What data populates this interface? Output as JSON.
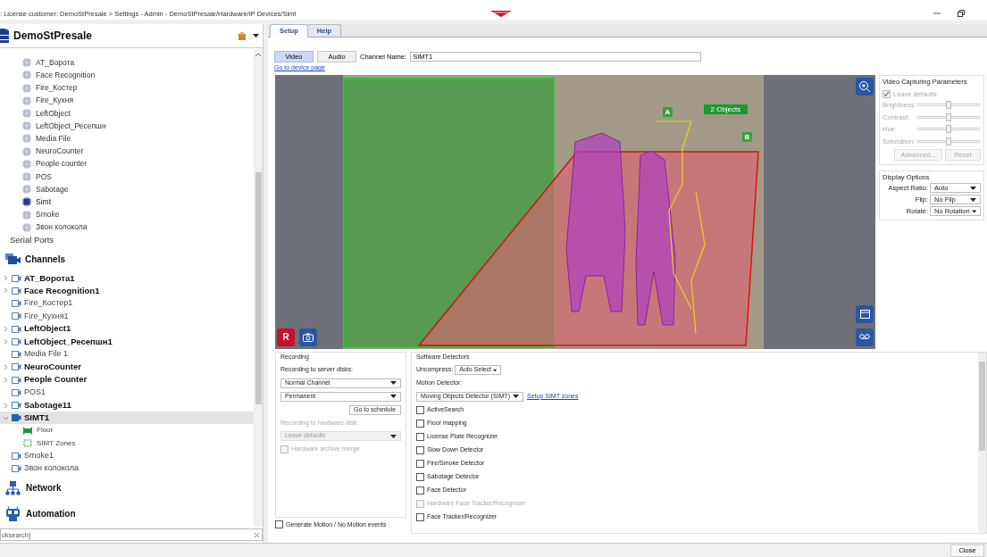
{
  "window": {
    "title": ": License customer: DemoStPresale > Settings - Admin - DemoStPresale/Hardware/IP Devices/Simt"
  },
  "sidebar": {
    "server": "DemoStPresale",
    "devices": [
      {
        "label": "AT_Ворота",
        "selected": false
      },
      {
        "label": "Face Recognition",
        "selected": false
      },
      {
        "label": "Fire_Костер",
        "selected": false
      },
      {
        "label": "Fire_Кухня",
        "selected": false
      },
      {
        "label": "LeftObject",
        "selected": false
      },
      {
        "label": "LeftObject_Ресепшн",
        "selected": false
      },
      {
        "label": "Media File",
        "selected": false
      },
      {
        "label": "NeuroCounter",
        "selected": false
      },
      {
        "label": "People counter",
        "selected": false
      },
      {
        "label": "POS",
        "selected": false
      },
      {
        "label": "Sabotage",
        "selected": false
      },
      {
        "label": "Simt",
        "selected": true
      },
      {
        "label": "Smoke",
        "selected": false
      },
      {
        "label": "Звон колокола",
        "selected": false
      }
    ],
    "serial_ports": "Serial Ports",
    "channels_title": "Channels",
    "channels": [
      {
        "label": "AT_Ворота1",
        "bold": true,
        "expandable": true,
        "expanded": false,
        "selected": false
      },
      {
        "label": "Face Recognition1",
        "bold": true,
        "expandable": true,
        "expanded": false,
        "selected": false
      },
      {
        "label": "Fire_Костер1",
        "bold": false,
        "expandable": false,
        "selected": false
      },
      {
        "label": "Fire_Кухня1",
        "bold": false,
        "expandable": false,
        "selected": false
      },
      {
        "label": "LeftObject1",
        "bold": true,
        "expandable": true,
        "expanded": false,
        "selected": false
      },
      {
        "label": "LeftObject_Ресепшн1",
        "bold": true,
        "expandable": true,
        "expanded": false,
        "selected": false
      },
      {
        "label": "Media File 1",
        "bold": false,
        "expandable": false,
        "selected": false
      },
      {
        "label": "NeuroCounter",
        "bold": true,
        "expandable": true,
        "expanded": false,
        "selected": false
      },
      {
        "label": "People Counter",
        "bold": true,
        "expandable": true,
        "expanded": false,
        "selected": false
      },
      {
        "label": "POS1",
        "bold": false,
        "expandable": false,
        "selected": false
      },
      {
        "label": "Sabotage11",
        "bold": true,
        "expandable": true,
        "expanded": false,
        "selected": false
      },
      {
        "label": "SIMT1",
        "bold": true,
        "expandable": true,
        "expanded": true,
        "selected": true,
        "children": [
          {
            "label": "Floor",
            "kind": "floor"
          },
          {
            "label": "SIMT Zones",
            "kind": "zones"
          }
        ]
      },
      {
        "label": "Smoke1",
        "bold": false,
        "expandable": false,
        "selected": false
      },
      {
        "label": "Звон колокола",
        "bold": false,
        "expandable": false,
        "selected": false
      }
    ],
    "sections": [
      {
        "label": "Network",
        "kind": "network"
      },
      {
        "label": "Automation",
        "kind": "automation"
      }
    ],
    "search": {
      "placeholder": "cksearch]"
    }
  },
  "tabs": [
    {
      "label": "Setup",
      "selected": true
    },
    {
      "label": "Help",
      "selected": false
    }
  ],
  "media_buttons": [
    {
      "label": "Video",
      "selected": true
    },
    {
      "label": "Audio",
      "selected": false
    }
  ],
  "channel_name": {
    "label": "Channel Name:",
    "value": "SIMT1"
  },
  "device_link": "Go to device page",
  "video": {
    "zone_labels": [
      {
        "label": "A",
        "kind": "tag"
      },
      {
        "label": "2 Objects",
        "kind": "count"
      },
      {
        "label": "B",
        "kind": "tag"
      }
    ],
    "record_button": "R"
  },
  "capture": {
    "title": "Video Capturing Parameters",
    "leave_defaults": {
      "label": "Leave defaults",
      "checked": true,
      "disabled": true
    },
    "sliders": [
      {
        "label": "Brightness:",
        "level": 0.5
      },
      {
        "label": "Contrast:",
        "level": 0.5
      },
      {
        "label": "Hue:",
        "level": 0.5
      },
      {
        "label": "Saturation:",
        "level": 0.5
      }
    ],
    "buttons": [
      "Advanced...",
      "Reset"
    ]
  },
  "display": {
    "title": "Display Options",
    "rows": [
      {
        "label": "Aspect Ratio:",
        "value": "Auto"
      },
      {
        "label": "Flip:",
        "value": "No Flip"
      },
      {
        "label": "Rotate:",
        "value": "No Rotation"
      }
    ]
  },
  "recording": {
    "title": "Recording",
    "server_label": "Recording to server disks:",
    "mode": "Normal Channel",
    "schedule": "Permanent",
    "schedule_button": "Go to schedule",
    "hardware_label": "Recording to hardware disk:",
    "hardware_value": "Leave defaults",
    "merge": {
      "label": "Hardware archive merge",
      "checked": false,
      "disabled": true
    }
  },
  "generate_events": {
    "label": "Generate Motion / No Motion events",
    "checked": false
  },
  "detectors": {
    "title": "Software Detectors",
    "uncompress_label": "Uncompress:",
    "uncompress": "Auto Select",
    "motion_label": "Motion Detector:",
    "motion": "Moving Objects Detector (SIMT)",
    "setup_link": "Setup SIMT zones",
    "items": [
      {
        "label": "ActiveSearch",
        "checked": false,
        "disabled": false
      },
      {
        "label": "Floor mapping",
        "checked": false,
        "disabled": false
      },
      {
        "label": "License Plate Recognizer",
        "checked": false,
        "disabled": false
      },
      {
        "label": "Slow Down Detector",
        "checked": false,
        "disabled": false
      },
      {
        "label": "Fire/Smoke Detector",
        "checked": false,
        "disabled": false
      },
      {
        "label": "Sabotage Detector",
        "checked": false,
        "disabled": false
      },
      {
        "label": "Face Detector",
        "checked": false,
        "disabled": false
      },
      {
        "label": "Hardware Face Tracker/Recognizer",
        "checked": false,
        "disabled": true
      },
      {
        "label": "Face Tracker/Recognizer",
        "checked": false,
        "disabled": false
      }
    ]
  },
  "close_button": "Close"
}
